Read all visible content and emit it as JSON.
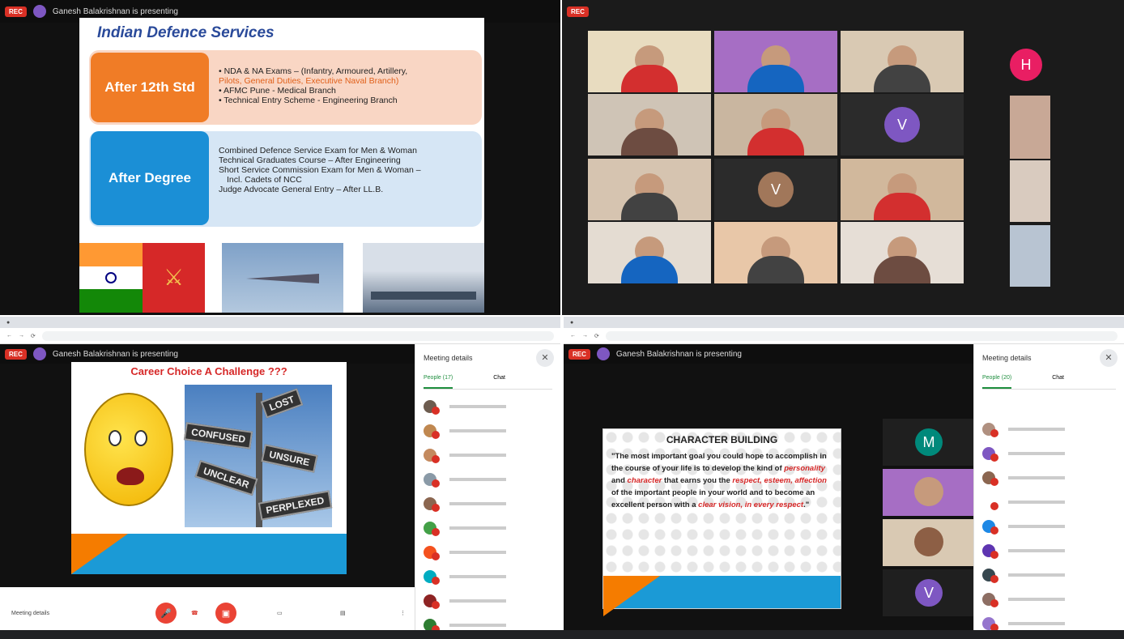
{
  "q1": {
    "presenter": "Ganesh Balakrishnan is presenting",
    "rec": "REC",
    "slide": {
      "title": "Indian Defence Services",
      "box1_label": "After 12th Std",
      "box1_lines": [
        "• NDA & NA Exams – (Infantry, Armoured, Artillery,",
        "Pilots, General Duties, Executive Naval Branch)",
        "• AFMC Pune - Medical Branch",
        "• Technical Entry Scheme - Engineering Branch"
      ],
      "box2_label": "After Degree",
      "box2_lines": [
        "Combined Defence Service Exam for Men & Woman",
        "Technical Graduates Course – After Engineering",
        "Short Service Commission Exam for Men & Woman –",
        "Incl. Cadets of NCC",
        "Judge Advocate General Entry – After LL.B."
      ]
    }
  },
  "q2": {
    "rec": "REC",
    "tiles": [
      {
        "initial": "",
        "color": "#e8dcc0"
      },
      {
        "initial": "",
        "color": "#a66ec4"
      },
      {
        "initial": "",
        "color": "#d9c9b3"
      },
      {
        "initial": "",
        "color": "#cfc4b6"
      },
      {
        "initial": "",
        "color": "#c9b6a0"
      },
      {
        "initial": "V",
        "color": "#7e57c2"
      },
      {
        "initial": "",
        "color": "#d6c4b0"
      },
      {
        "initial": "V",
        "color": "#a1775a"
      },
      {
        "initial": "",
        "color": "#d1b89c"
      },
      {
        "initial": "",
        "color": "#e4dcd2"
      },
      {
        "initial": "",
        "color": "#e8c7a8"
      },
      {
        "initial": "",
        "color": "#e6ded6"
      }
    ],
    "side_initial": "H"
  },
  "q3": {
    "presenter": "Ganesh Balakrishnan is presenting",
    "rec": "REC",
    "slide_title": "Career Choice A Challenge ???",
    "signs": [
      "LOST",
      "CONFUSED",
      "UNSURE",
      "UNCLEAR",
      "PERPLEXED"
    ],
    "panel_title": "Meeting details",
    "tab_people": "People (17)",
    "tab_chat": "Chat",
    "participants": [
      {
        "initial": "",
        "color": "#6d5c4f"
      },
      {
        "initial": "",
        "color": "#c08850"
      },
      {
        "initial": "",
        "color": "#c48a5f"
      },
      {
        "initial": "",
        "color": "#8a9aa7"
      },
      {
        "initial": "",
        "color": "#8b6650"
      },
      {
        "initial": "",
        "color": "#43a047"
      },
      {
        "initial": "",
        "color": "#f4511e"
      },
      {
        "initial": "",
        "color": "#00acc1"
      },
      {
        "initial": "",
        "color": "#8e2424"
      },
      {
        "initial": "",
        "color": "#2e7d32"
      }
    ],
    "meeting_details": "Meeting details"
  },
  "q4": {
    "presenter": "Ganesh Balakrishnan is presenting",
    "rec": "REC",
    "slide_title": "CHARACTER BUILDING",
    "quote_a": "\"The most important goal you could hope to accomplish in the course of your life is to develop the kind of ",
    "quote_personality": "personality",
    "quote_and": " and ",
    "quote_character": "character",
    "quote_b": " that earns you the ",
    "quote_respect": "respect, esteem, affection",
    "quote_c": " of the important people in your world and to become an excellent person with a ",
    "quote_clear": "clear vision, in every respect",
    "quote_end": ".\"",
    "panel_title": "Meeting details",
    "tab_people": "People (20)",
    "tab_chat": "Chat",
    "tile_initials": [
      "M",
      "",
      "",
      "V"
    ],
    "participants": [
      {
        "initial": "",
        "color": "#b09080"
      },
      {
        "initial": "",
        "color": "#7e57c2"
      },
      {
        "initial": "",
        "color": "#8b6650"
      },
      {
        "initial": "",
        "color": "#ffffff"
      },
      {
        "initial": "",
        "color": "#1e88e5"
      },
      {
        "initial": "",
        "color": "#5e35b1"
      },
      {
        "initial": "",
        "color": "#37474f"
      },
      {
        "initial": "",
        "color": "#8d6e63"
      },
      {
        "initial": "",
        "color": "#9575cd"
      },
      {
        "initial": "",
        "color": "#90a4ae"
      }
    ]
  }
}
